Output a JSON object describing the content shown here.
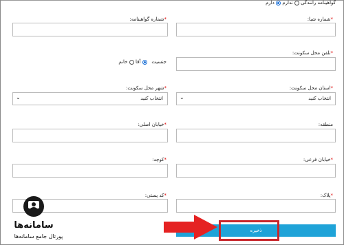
{
  "header": {
    "license_question": "گواهینامه رانندگی",
    "opt_no": "ندارم",
    "opt_yes": "دارم"
  },
  "fields": {
    "shaba": "شماره شبا:",
    "license_no": "شماره گواهینامه:",
    "home_phone": "تلفن محل سکونت:",
    "gender": "جنسیت",
    "male": "آقا",
    "female": "خانم",
    "province": "استان محل سکونت:",
    "city": "شهر محل سکونت:",
    "select_placeholder": "انتخاب کنید",
    "region": "منطقه:",
    "main_street": "خیابان اصلی:",
    "side_street": "خیابان فرعی:",
    "alley": "کوچه:",
    "plaque": "پلاک:",
    "postal_code": "کد پستی:"
  },
  "save_label": "ذخیره",
  "watermark": {
    "line1": "سامانه‌ها",
    "line2": "پورتال جامع سامانه‌ها"
  },
  "colors": {
    "accent": "#1fa3d8",
    "highlight": "#c8262b",
    "required": "#dd0000"
  }
}
